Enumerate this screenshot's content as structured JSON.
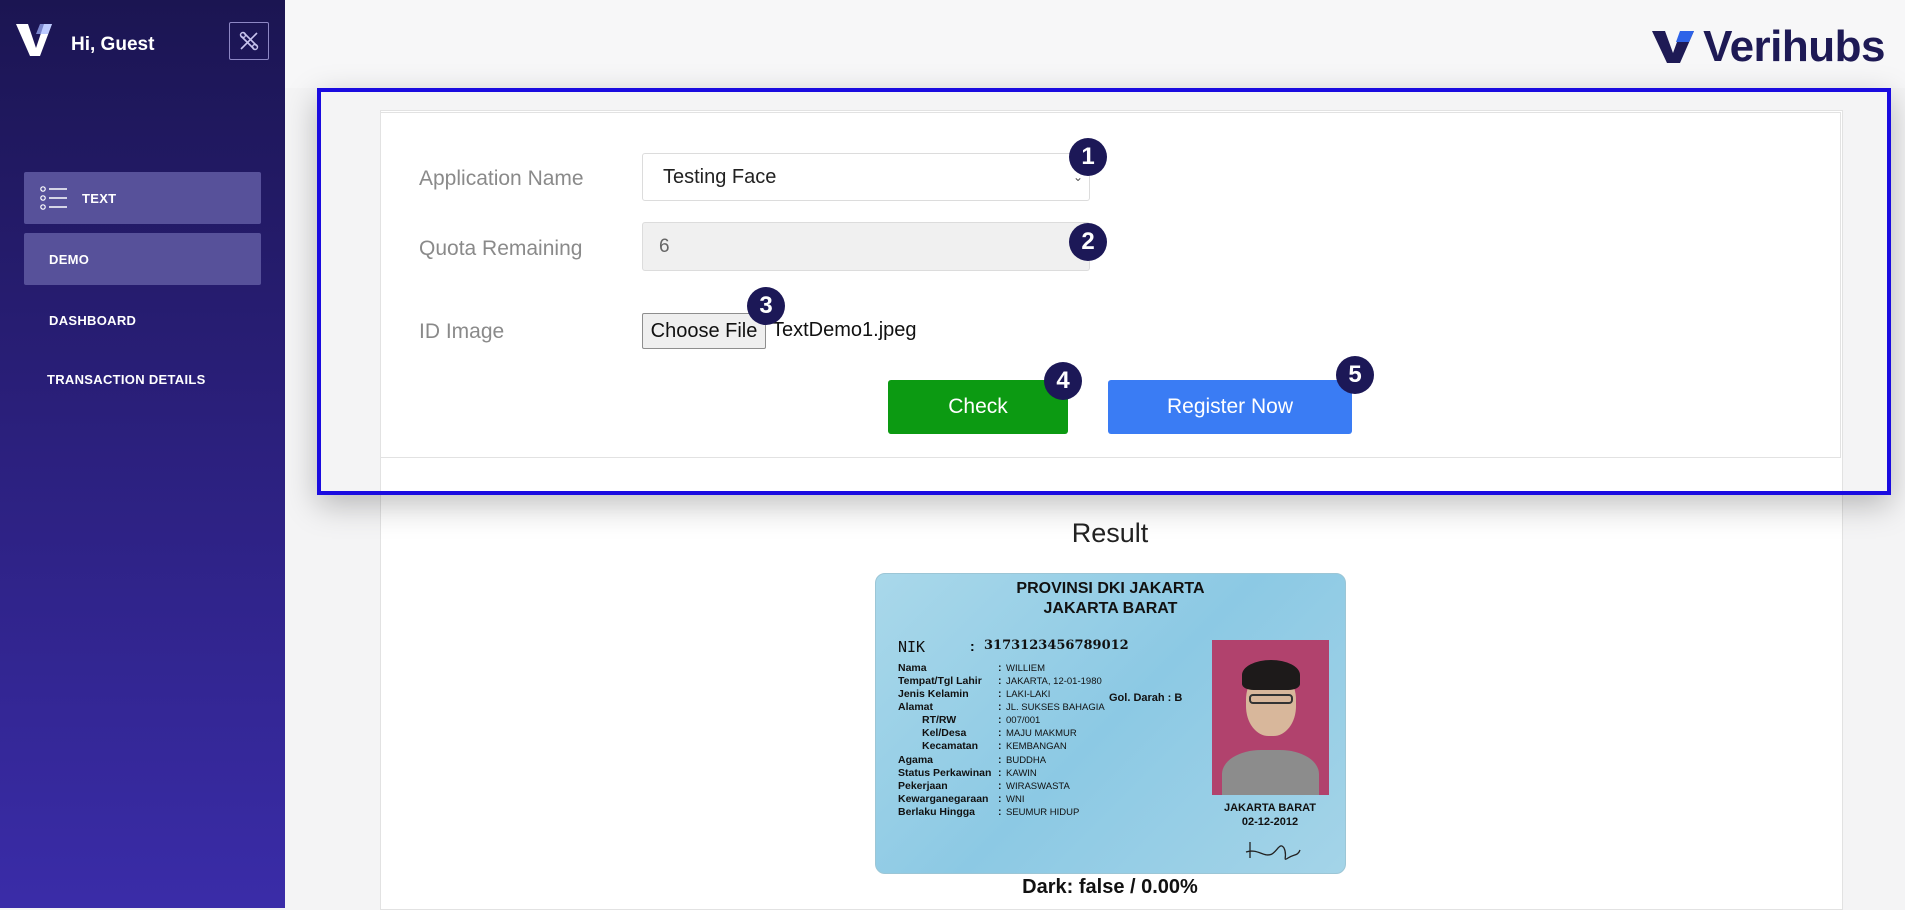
{
  "sidebar": {
    "greeting": "Hi, Guest",
    "items": [
      {
        "label": "TEXT"
      },
      {
        "label": "DEMO"
      },
      {
        "label": "DASHBOARD"
      },
      {
        "label": "TRANSACTION DETAILS"
      }
    ]
  },
  "header": {
    "logo_text": "Verihubs"
  },
  "form": {
    "app_name_label": "Application Name",
    "app_name_value": "Testing Face",
    "quota_label": "Quota Remaining",
    "quota_value": "6",
    "id_image_label": "ID Image",
    "choose_file_label": "Choose File",
    "file_name": "TextDemo1.jpeg",
    "check_label": "Check",
    "register_label": "Register Now"
  },
  "badges": [
    "1",
    "2",
    "3",
    "4",
    "5"
  ],
  "result": {
    "title": "Result",
    "card": {
      "province": "PROVINSI DKI JAKARTA",
      "city": "JAKARTA BARAT",
      "nik_label": "NIK",
      "nik_value": "3173123456789012",
      "fields": [
        {
          "k": "Nama",
          "v": "WILLIEM"
        },
        {
          "k": "Tempat/Tgl Lahir",
          "v": "JAKARTA, 12-01-1980"
        },
        {
          "k": "Jenis Kelamin",
          "v": "LAKI-LAKI"
        },
        {
          "k": "Alamat",
          "v": "JL. SUKSES BAHAGIA"
        },
        {
          "k": "RT/RW",
          "v": "007/001"
        },
        {
          "k": "Kel/Desa",
          "v": "MAJU MAKMUR"
        },
        {
          "k": "Kecamatan",
          "v": "KEMBANGAN"
        },
        {
          "k": "Agama",
          "v": "BUDDHA"
        },
        {
          "k": "Status Perkawinan",
          "v": "KAWIN"
        },
        {
          "k": "Pekerjaan",
          "v": "WIRASWASTA"
        },
        {
          "k": "Kewarganegaraan",
          "v": "WNI"
        },
        {
          "k": "Berlaku Hingga",
          "v": "SEUMUR HIDUP"
        }
      ],
      "blood_type": "Gol. Darah : B",
      "issue_place": "JAKARTA BARAT",
      "issue_date": "02-12-2012"
    },
    "dark_status": "Dark: false / 0.00%"
  },
  "colors": {
    "sidebar_top": "#1b1552",
    "sidebar_bottom": "#3a2ca8",
    "check_button": "#0c9a12",
    "register_button": "#3a7cf4",
    "highlight_border": "#1a0be0",
    "badge": "#1c1857"
  }
}
